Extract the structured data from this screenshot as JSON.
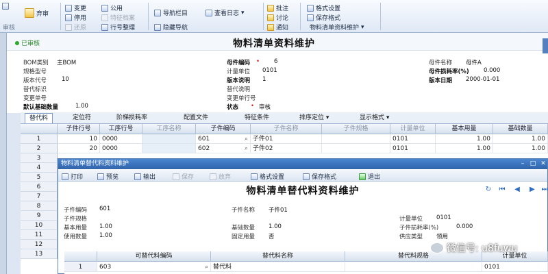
{
  "ribbon": {
    "approve": "弃审",
    "audit_group": "审核",
    "change": "变更",
    "disable": "停用",
    "restore": "还原",
    "public": "公用",
    "feature_files": "特征档案",
    "row_arrange": "行号整理",
    "nav_bar": "导航栏目",
    "hide_nav": "隐藏导航",
    "view_log": "查看日志",
    "annotate": "批注",
    "discuss": "讨论",
    "notify": "通知",
    "format_settings": "格式设置",
    "save_format": "保存格式",
    "format_name": "物料清单资料维护"
  },
  "form": {
    "status": "已审核",
    "title": "物料清单资料维护",
    "fields": {
      "bom_type_label": "BOM类别",
      "bom_type_value": "主BOM",
      "spec_label": "规格型号",
      "version_code_label": "版本代号",
      "version_code_value": "10",
      "substitute_label": "替代标识",
      "change_no_label": "变更单号",
      "base_qty_label": "默认基础数量",
      "base_qty_value": "1.00",
      "parent_code_label": "母件编码",
      "parent_code_value": "6",
      "uom_label": "计量单位",
      "uom_value": "0101",
      "version_desc_label": "版本说明",
      "version_desc_value": "1",
      "substitute_desc_label": "替代说明",
      "change_line_label": "变更单行号",
      "state_label": "状态",
      "state_value": "审核",
      "parent_name_label": "母件名称",
      "parent_name_value": "母件A",
      "loss_rate_label": "母件损耗率(%)",
      "loss_rate_value": "0.000",
      "version_date_label": "版本日期",
      "version_date_value": "2000-01-01"
    }
  },
  "tabs": [
    "替代料",
    "定位符",
    "阶梯损耗率",
    "配置文件",
    "特征条件",
    "排序定位",
    "显示格式"
  ],
  "grid": {
    "columns": [
      "子件行号",
      "工序行号",
      "工序名称",
      "子件编码",
      "子件名称",
      "子件规格",
      "计量单位",
      "基本用量",
      "基础数量"
    ],
    "rows": [
      {
        "n": "1",
        "line": "10",
        "op": "0000",
        "opname": "",
        "code": "601",
        "name": "子件01",
        "spec": "",
        "uom": "0101",
        "qty": "1.00",
        "base": "1.00"
      },
      {
        "n": "2",
        "line": "20",
        "op": "0000",
        "opname": "",
        "code": "602",
        "name": "子件02",
        "spec": "",
        "uom": "0101",
        "qty": "1.00",
        "base": "1.00"
      }
    ],
    "row_numbers": [
      "3",
      "4",
      "5",
      "6",
      "7",
      "8",
      "9",
      "10",
      "11",
      "12",
      "13"
    ]
  },
  "dialog": {
    "window_title": "物料清单替代料资料维护",
    "print": "打印",
    "preview": "预览",
    "output": "输出",
    "save": "保存",
    "discard": "放弃",
    "format_settings": "格式设置",
    "save_format": "保存格式",
    "exit": "退出",
    "title": "物料清单替代料资料维护",
    "fields": {
      "child_code_label": "子件编码",
      "child_code_value": "601",
      "child_spec_label": "子件规格",
      "base_usage_label": "基本用量",
      "base_usage_value": "1.00",
      "usage_qty_label": "使用数量",
      "usage_qty_value": "1.00",
      "child_name_label": "子件名称",
      "child_name_value": "子件01",
      "base_qty_label": "基础数量",
      "base_qty_value": "1.00",
      "fixed_usage_label": "固定用量",
      "fixed_usage_value": "否",
      "uom_label": "计量单位",
      "uom_value": "0101",
      "loss_label": "子件损耗率(%)",
      "loss_value": "0.000",
      "supply_label": "供应类型",
      "supply_value": "领用"
    },
    "grid": {
      "columns": [
        "可替代料编码",
        "替代料名称",
        "替代料规格",
        "计量单位"
      ],
      "rows": [
        {
          "n": "1",
          "code": "603",
          "name": "替代料",
          "spec": "",
          "uom": "0101"
        }
      ]
    }
  },
  "watermark": "微信号: u8fuwu"
}
